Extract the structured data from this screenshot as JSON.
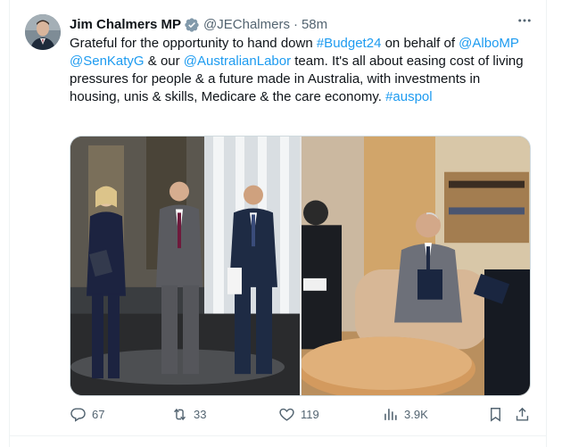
{
  "tweet": {
    "author_name": "Jim Chalmers MP",
    "handle": "@JEChalmers",
    "separator": "·",
    "time": "58m",
    "text_parts": [
      {
        "text": "Grateful for the opportunity to hand down ",
        "link": false
      },
      {
        "text": "#Budget24",
        "link": true
      },
      {
        "text": " on behalf of ",
        "link": false
      },
      {
        "text": "@AlboMP",
        "link": true
      },
      {
        "text": " ",
        "link": false
      },
      {
        "text": "@SenKatyG",
        "link": true
      },
      {
        "text": " & our ",
        "link": false
      },
      {
        "text": "@AustralianLabor",
        "link": true
      },
      {
        "text": " team. It's all about easing cost of living pressures for people & a future made in Australia, with investments in housing, unis & skills, Medicare & the care economy. ",
        "link": false
      },
      {
        "text": "#auspol",
        "link": true
      }
    ],
    "media": [
      {
        "icon": "photo-group-walking"
      },
      {
        "icon": "photo-office-meeting"
      }
    ]
  },
  "actions": {
    "replies": "67",
    "reposts": "33",
    "likes": "119",
    "views": "3.9K"
  },
  "colors": {
    "accent": "#1d9bf0",
    "text": "#0f1419",
    "muted": "#536471",
    "verified_badge": "#829aab"
  }
}
